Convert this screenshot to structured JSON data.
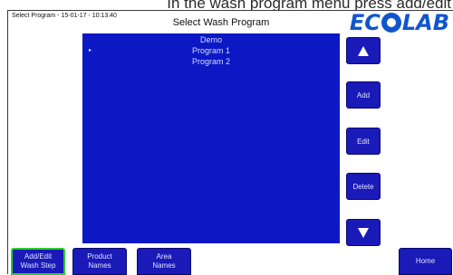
{
  "instruction": "In the wash program menu press add/edit",
  "header": {
    "status": "Select Program - 15-01-17 - 10:13:40",
    "title": "Select Wash Program",
    "logo": "ECOLAB"
  },
  "program_list": {
    "items": [
      "Demo",
      "Program 1",
      "Program 2"
    ],
    "selected_index": 1,
    "marker": "▸"
  },
  "side_buttons": {
    "add": "Add",
    "edit": "Edit",
    "delete": "Delete",
    "up_icon": "arrow-up-icon",
    "down_icon": "arrow-down-icon"
  },
  "bottom_buttons": {
    "add_edit_wash_step": [
      "Add/Edit",
      "Wash Step"
    ],
    "product_names": [
      "Product",
      "Names"
    ],
    "area_names": [
      "Area",
      "Names"
    ],
    "home": "Home"
  },
  "colors": {
    "panel": "#0b18c4",
    "button": "#1a1ab8",
    "active_outline": "#2ecc2e",
    "logo": "#1155cc"
  }
}
